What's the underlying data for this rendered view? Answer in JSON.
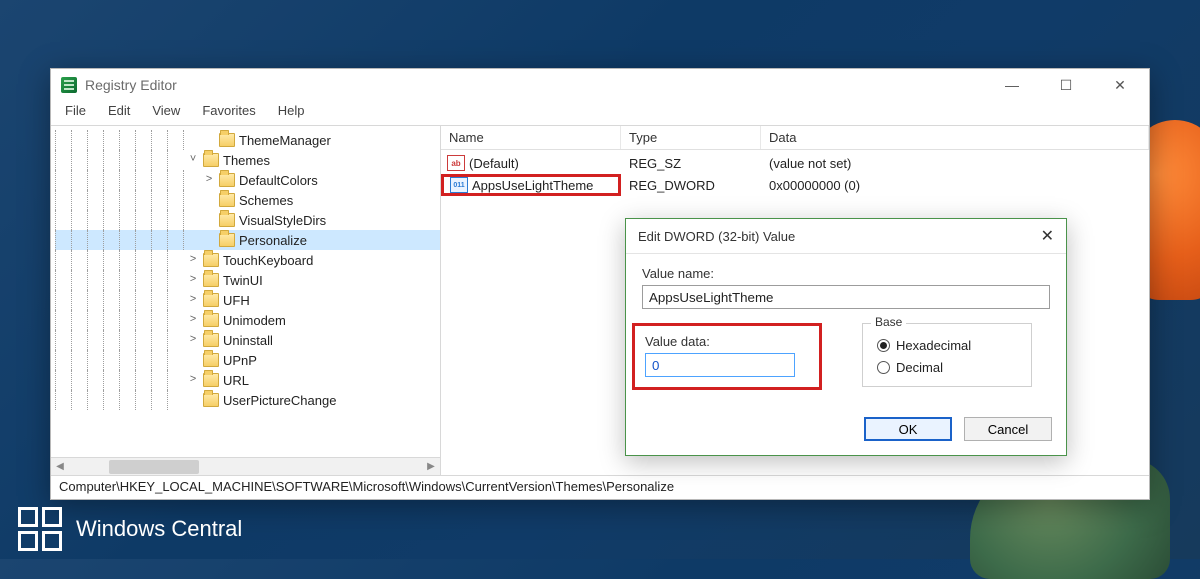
{
  "app": {
    "title": "Registry Editor",
    "menu": [
      "File",
      "Edit",
      "View",
      "Favorites",
      "Help"
    ],
    "window_buttons": {
      "min": "—",
      "max": "☐",
      "close": "✕"
    }
  },
  "tree": {
    "items": [
      {
        "depth": 9,
        "tw": "",
        "label": "ThemeManager"
      },
      {
        "depth": 8,
        "tw": "v",
        "label": "Themes"
      },
      {
        "depth": 9,
        "tw": ">",
        "label": "DefaultColors"
      },
      {
        "depth": 9,
        "tw": "",
        "label": "Schemes"
      },
      {
        "depth": 9,
        "tw": "",
        "label": "VisualStyleDirs"
      },
      {
        "depth": 9,
        "tw": "",
        "label": "Personalize",
        "selected": true
      },
      {
        "depth": 8,
        "tw": ">",
        "label": "TouchKeyboard"
      },
      {
        "depth": 8,
        "tw": ">",
        "label": "TwinUI"
      },
      {
        "depth": 8,
        "tw": ">",
        "label": "UFH"
      },
      {
        "depth": 8,
        "tw": ">",
        "label": "Unimodem"
      },
      {
        "depth": 8,
        "tw": ">",
        "label": "Uninstall"
      },
      {
        "depth": 8,
        "tw": "",
        "label": "UPnP"
      },
      {
        "depth": 8,
        "tw": ">",
        "label": "URL"
      },
      {
        "depth": 8,
        "tw": "",
        "label": "UserPictureChange"
      }
    ]
  },
  "list": {
    "headers": {
      "name": "Name",
      "type": "Type",
      "data": "Data"
    },
    "rows": [
      {
        "icon": "sz",
        "name": "(Default)",
        "type": "REG_SZ",
        "data": "(value not set)",
        "highlight": false
      },
      {
        "icon": "dw",
        "name": "AppsUseLightTheme",
        "type": "REG_DWORD",
        "data": "0x00000000 (0)",
        "highlight": true
      }
    ]
  },
  "statusbar": "Computer\\HKEY_LOCAL_MACHINE\\SOFTWARE\\Microsoft\\Windows\\CurrentVersion\\Themes\\Personalize",
  "dialog": {
    "title": "Edit DWORD (32-bit) Value",
    "value_name_label": "Value name:",
    "value_name": "AppsUseLightTheme",
    "value_data_label": "Value data:",
    "value_data": "0",
    "base_legend": "Base",
    "radios": {
      "hex": "Hexadecimal",
      "dec": "Decimal"
    },
    "ok": "OK",
    "cancel": "Cancel"
  },
  "watermark": "Windows Central"
}
